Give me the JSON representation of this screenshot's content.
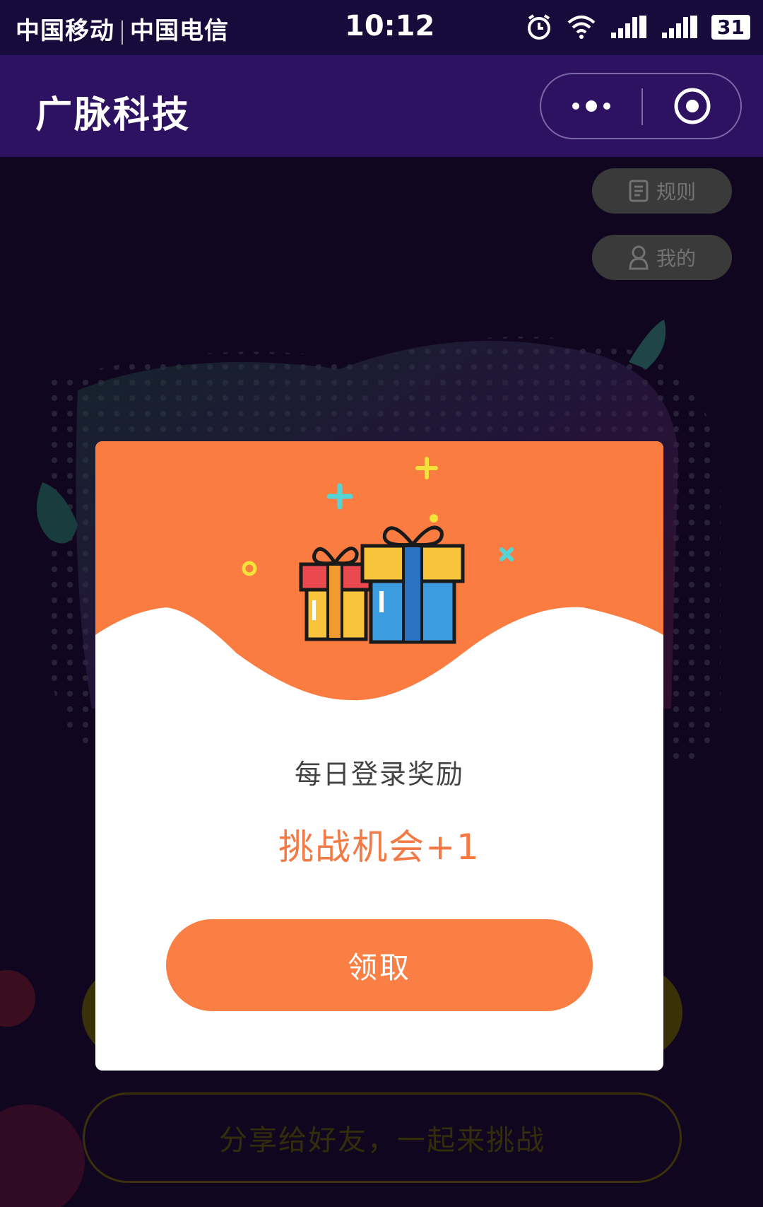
{
  "status_bar": {
    "carrier_1": "中国移动",
    "carrier_2": "中国电信",
    "time": "10:12",
    "battery": "31"
  },
  "nav": {
    "title": "广脉科技",
    "more_icon": "more-dots-icon",
    "close_icon": "target-close-icon"
  },
  "page": {
    "rules_label": "规则",
    "mine_label": "我的",
    "share_label": "分享给好友，一起来挑战"
  },
  "modal": {
    "reward_label": "每日登录奖励",
    "reward_value": "挑战机会+1",
    "claim_label": "领取"
  },
  "colors": {
    "accent": "#f97f44",
    "nav_bg": "#2c1260",
    "status_bg": "#160b3a"
  }
}
